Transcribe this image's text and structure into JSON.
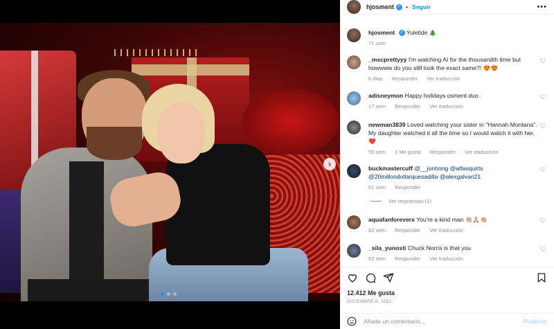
{
  "post": {
    "author": "hjosment",
    "follow_label": "Seguir",
    "menu_glyph": "•••",
    "caption_author": "hjosment",
    "caption_text": "Yuletide 🎄",
    "caption_time": "71 sem",
    "likes": "12.412 Me gusta",
    "date": "DICIEMBRE 6, 2021",
    "add_comment_placeholder": "Añade un comentario...",
    "publish_label": "Publicar"
  },
  "comments": [
    {
      "user": "_mscprettyyy",
      "text": "I'm watching AI for the thousandth time but howwww do you still look the exact same?! 😍😍",
      "time": "6 días",
      "reply": "Responder",
      "translate": "Ver traducción"
    },
    {
      "user": "adisneymon",
      "text": "Happy holidays osment duo",
      "time": "17 sem",
      "reply": "Responder",
      "translate": "Ver traducción"
    },
    {
      "user": "newman3839",
      "text": "Loved watching your sister in \"Hannah Montana\". My daughter watched it all the time so I would watch it with her. ❤️",
      "time": "55 sem",
      "likes": "1 Me gusta",
      "reply": "Responder",
      "translate": "Ver traducción"
    },
    {
      "user": "buckmastercuff",
      "mention1": "@__jonhong",
      "mention2": "@alfasquirts",
      "mention3": "@20millondollarquesadilla",
      "mention4": "@alexgalvan21",
      "time": "61 sem",
      "reply": "Responder"
    },
    {
      "user": "aquafanforeverx",
      "text": "You're a kind man 👏🏼🙏🏼👏🏼",
      "time": "62 sem",
      "reply": "Responder",
      "translate": "Ver traducción"
    },
    {
      "user": "_sila_yunosti",
      "text": "Chuck Norris is that you",
      "time": "62 sem",
      "reply": "Responder",
      "translate": "Ver traducción"
    }
  ],
  "view_replies": "Ver respuestas (1)",
  "icons": {
    "heart": "heart-icon",
    "comment": "comment-icon",
    "share": "share-icon",
    "bookmark": "bookmark-icon",
    "emoji": "emoji-icon",
    "next": "chevron-right-icon"
  },
  "colors": {
    "link": "#0095f6",
    "verified": "#3897f0",
    "mention": "#00376b"
  }
}
